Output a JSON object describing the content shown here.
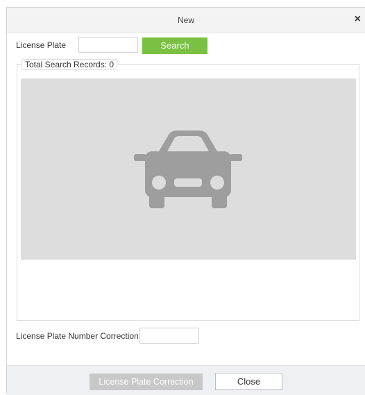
{
  "dialog": {
    "title": "New",
    "close_icon": "close-icon",
    "close_glyph": "×"
  },
  "search": {
    "license_plate_label": "License Plate",
    "license_plate_value": "",
    "search_button_label": "Search"
  },
  "records": {
    "legend": "Total Search Records: 0",
    "placeholder_icon": "car-icon"
  },
  "correction": {
    "label": "License Plate Number Correction",
    "value": ""
  },
  "footer": {
    "correction_button_label": "License Plate Correction",
    "close_button_label": "Close"
  },
  "colors": {
    "accent": "#7ac143",
    "disabled_button": "#c8c8c8",
    "image_placeholder_bg": "#dddddd",
    "car_icon": "#9e9e9e"
  }
}
